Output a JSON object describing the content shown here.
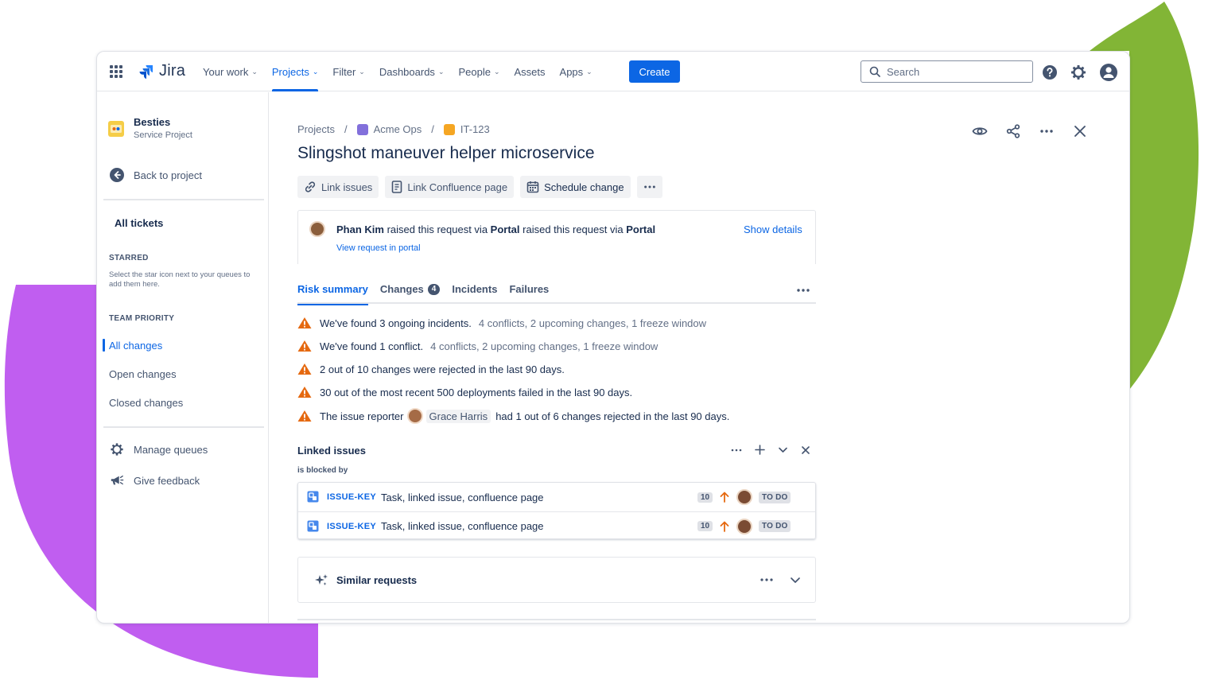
{
  "app": {
    "brand": "Jira",
    "colors": {
      "primary": "#0c66e4",
      "warning": "#e56910",
      "project_icon": "#f5cd47",
      "deco_purple": "#c05ef0",
      "deco_green": "#82b536"
    }
  },
  "nav": {
    "items": [
      {
        "label": "Your work",
        "dropdown": true,
        "active": false
      },
      {
        "label": "Projects",
        "dropdown": true,
        "active": true
      },
      {
        "label": "Filter",
        "dropdown": true,
        "active": false
      },
      {
        "label": "Dashboards",
        "dropdown": true,
        "active": false
      },
      {
        "label": "People",
        "dropdown": true,
        "active": false
      },
      {
        "label": "Assets",
        "dropdown": false,
        "active": false
      },
      {
        "label": "Apps",
        "dropdown": true,
        "active": false
      }
    ],
    "create_label": "Create",
    "search_placeholder": "Search",
    "icons": [
      "app-switcher-icon",
      "help-icon",
      "settings-icon",
      "profile-icon"
    ]
  },
  "sidebar": {
    "project_name": "Besties",
    "project_type": "Service Project",
    "back_label": "Back to project",
    "all_tickets": "All tickets",
    "starred_heading": "STARRED",
    "starred_hint": "Select the star icon next to your queues to add them here.",
    "team_priority_heading": "TEAM PRIORITY",
    "queues": [
      {
        "label": "All changes",
        "active": true
      },
      {
        "label": "Open changes",
        "active": false
      },
      {
        "label": "Closed changes",
        "active": false
      }
    ],
    "manage_queues": "Manage queues",
    "give_feedback": "Give feedback"
  },
  "issue": {
    "breadcrumbs": [
      "Projects",
      "Acme Ops",
      "IT-123"
    ],
    "title": "Slingshot maneuver helper microservice",
    "actions": [
      "Link issues",
      "Link Confluence page",
      "Schedule change"
    ],
    "request": {
      "reporter": "Phan Kim",
      "text1": "raised this request via",
      "channel1": "Portal",
      "text2": "raised this request via",
      "channel2": "Portal",
      "view_link": "View request in portal",
      "show_details": "Show details"
    },
    "tabs": [
      {
        "label": "Risk summary",
        "active": true
      },
      {
        "label": "Changes",
        "badge": "4"
      },
      {
        "label": "Incidents"
      },
      {
        "label": "Failures"
      }
    ],
    "risks": [
      {
        "text": "We've found 3 ongoing incidents.",
        "muted": "4 conflicts, 2 upcoming changes, 1 freeze window"
      },
      {
        "text": "We've found 1 conflict.",
        "muted": "4 conflicts, 2 upcoming changes, 1 freeze window"
      },
      {
        "text": "2 out of 10 changes were rejected in the last 90 days.",
        "muted": ""
      },
      {
        "text": "30 out of the most recent 500 deployments failed in the last 90 days.",
        "muted": ""
      }
    ],
    "risk_reporter": {
      "prefix": "The issue reporter",
      "name": "Grace Harris",
      "suffix": "had 1 out of 6 changes rejected in the last 90 days."
    },
    "linked": {
      "title": "Linked issues",
      "relation": "is blocked by",
      "rows": [
        {
          "key": "ISSUE-KEY",
          "summary": "Task, linked issue, confluence page",
          "estimate": "10",
          "status": "TO DO"
        },
        {
          "key": "ISSUE-KEY",
          "summary": "Task, linked issue, confluence page",
          "estimate": "10",
          "status": "TO DO"
        }
      ]
    },
    "similar_label": "Similar requests"
  }
}
